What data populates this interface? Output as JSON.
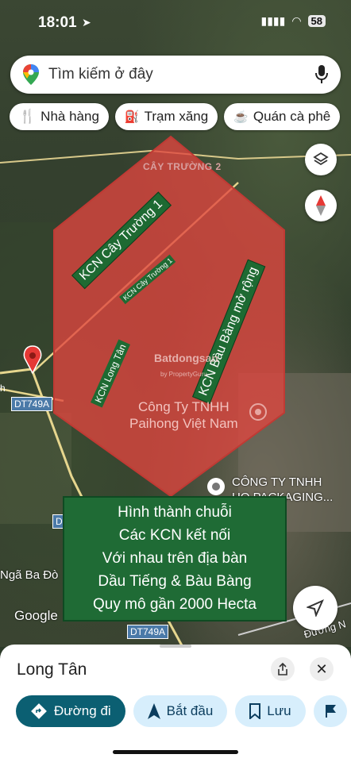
{
  "status_bar": {
    "time": "18:01",
    "battery": "58"
  },
  "search": {
    "placeholder": "Tìm kiếm ở đây"
  },
  "chips": [
    {
      "label": "Nhà hàng",
      "icon": "fork-knife-icon"
    },
    {
      "label": "Trạm xăng",
      "icon": "gas-station-icon"
    },
    {
      "label": "Quán cà phê",
      "icon": "coffee-icon"
    }
  ],
  "map": {
    "labels": {
      "cay_truong_2": "CÂY TRƯỜNG 2",
      "kcn_cay_truong_1": "KCN Cây Trường 1",
      "kcn_cay_truong_1_small": "KCN Cây Trường 1",
      "kcn_bau_bang": "KCN Bàu Bàng mở rộng",
      "kcn_long_tan": "KCN Long Tân",
      "paihong": "Công Ty TNHH Paihong Việt Nam",
      "paihong_line1": "Công Ty TNHH",
      "paihong_line2": "Paihong Việt Nam",
      "cong_ty_line1": "CÔNG TY TNHH",
      "cong_ty_line2": "HQ PACKAGING...",
      "dt749a_1": "DT749A",
      "dt749a_2": "DT749A",
      "nga_ba": "Ngã Ba Đò",
      "duong": "Đường N",
      "google": "Google",
      "watermark": "Batdongsan",
      "watermark_sub": "by PropertyGuru",
      "dt_partial_1": "h",
      "dt_partial_2": "D"
    },
    "highlight_color": "#e0453f"
  },
  "overlay_text": {
    "line1": "Hình thành chuỗi",
    "line2": "Các KCN kết nối",
    "line3": "Với nhau trên địa bàn",
    "line4": "Dầu Tiếng & Bàu Bàng",
    "line5": "Quy mô gần 2000 Hecta"
  },
  "sheet": {
    "title": "Long Tân",
    "actions": [
      {
        "label": "Đường đi",
        "icon": "directions-icon"
      },
      {
        "label": "Bắt đầu",
        "icon": "navigation-arrow-icon"
      },
      {
        "label": "Lưu",
        "icon": "bookmark-icon"
      }
    ]
  }
}
